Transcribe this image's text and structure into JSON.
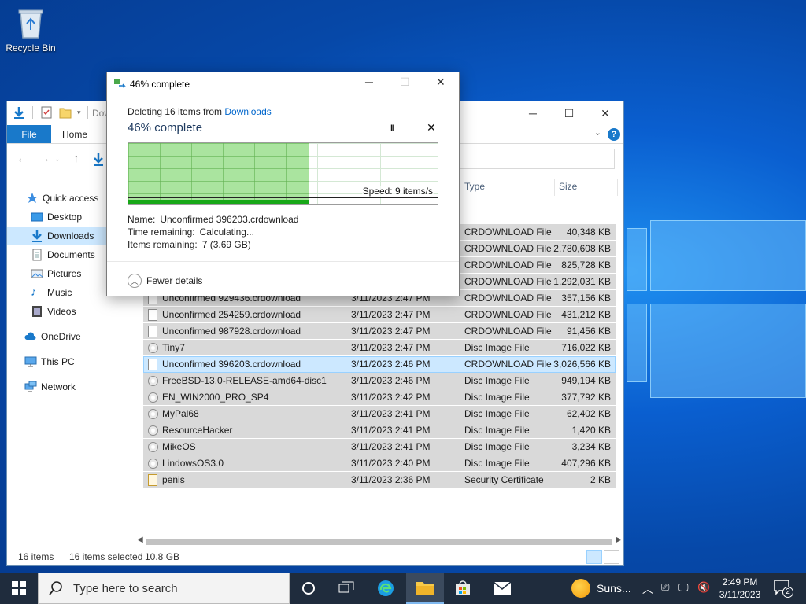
{
  "desktop": {
    "recycle_bin_label": "Recycle Bin"
  },
  "explorer": {
    "title_partial": "Dow",
    "tabs": {
      "file": "File",
      "home": "Home"
    },
    "help_label": "?",
    "nav": {
      "quick_access": "Quick access",
      "desktop": "Desktop",
      "downloads": "Downloads",
      "documents": "Documents",
      "pictures": "Pictures",
      "music": "Music",
      "videos": "Videos",
      "onedrive": "OneDrive",
      "this_pc": "This PC",
      "network": "Network"
    },
    "columns": {
      "type": "Type",
      "size": "Size"
    },
    "files": [
      {
        "name": "",
        "date": "",
        "type": "CRDOWNLOAD File",
        "size": "40,348 KB",
        "icon": "file-icon"
      },
      {
        "name": "",
        "date": "",
        "type": "CRDOWNLOAD File",
        "size": "2,780,608 KB",
        "icon": "file-icon"
      },
      {
        "name": "",
        "date": "",
        "type": "CRDOWNLOAD File",
        "size": "825,728 KB",
        "icon": "file-icon"
      },
      {
        "name": "",
        "date": "",
        "type": "CRDOWNLOAD File",
        "size": "1,292,031 KB",
        "icon": "file-icon"
      },
      {
        "name": "Unconfirmed 929436.crdownload",
        "date": "3/11/2023 2:47 PM",
        "type": "CRDOWNLOAD File",
        "size": "357,156 KB",
        "icon": "file-icon"
      },
      {
        "name": "Unconfirmed 254259.crdownload",
        "date": "3/11/2023 2:47 PM",
        "type": "CRDOWNLOAD File",
        "size": "431,212 KB",
        "icon": "file-icon"
      },
      {
        "name": "Unconfirmed 987928.crdownload",
        "date": "3/11/2023 2:47 PM",
        "type": "CRDOWNLOAD File",
        "size": "91,456 KB",
        "icon": "file-icon"
      },
      {
        "name": "Tiny7",
        "date": "3/11/2023 2:47 PM",
        "type": "Disc Image File",
        "size": "716,022 KB",
        "icon": "disc-image-icon"
      },
      {
        "name": "Unconfirmed 396203.crdownload",
        "date": "3/11/2023 2:46 PM",
        "type": "CRDOWNLOAD File",
        "size": "3,026,566 KB",
        "icon": "file-icon"
      },
      {
        "name": "FreeBSD-13.0-RELEASE-amd64-disc1",
        "date": "3/11/2023 2:46 PM",
        "type": "Disc Image File",
        "size": "949,194 KB",
        "icon": "disc-image-icon"
      },
      {
        "name": "EN_WIN2000_PRO_SP4",
        "date": "3/11/2023 2:42 PM",
        "type": "Disc Image File",
        "size": "377,792 KB",
        "icon": "disc-image-icon"
      },
      {
        "name": "MyPal68",
        "date": "3/11/2023 2:41 PM",
        "type": "Disc Image File",
        "size": "62,402 KB",
        "icon": "disc-image-icon"
      },
      {
        "name": "ResourceHacker",
        "date": "3/11/2023 2:41 PM",
        "type": "Disc Image File",
        "size": "1,420 KB",
        "icon": "disc-image-icon"
      },
      {
        "name": "MikeOS",
        "date": "3/11/2023 2:41 PM",
        "type": "Disc Image File",
        "size": "3,234 KB",
        "icon": "disc-image-icon"
      },
      {
        "name": "LindowsOS3.0",
        "date": "3/11/2023 2:40 PM",
        "type": "Disc Image File",
        "size": "407,296 KB",
        "icon": "disc-image-icon"
      },
      {
        "name": "penis",
        "date": "3/11/2023 2:36 PM",
        "type": "Security Certificate",
        "size": "2 KB",
        "icon": "certificate-icon"
      }
    ],
    "status": {
      "item_count": "16 items",
      "selected": "16 items selected",
      "selected_size": "10.8 GB"
    }
  },
  "dialog": {
    "title": "46% complete",
    "subtitle_prefix": "Deleting 16 items from",
    "subtitle_link": "Downloads",
    "heading": "46% complete",
    "pause_label": "II",
    "cancel_label": "✕",
    "progress_fraction": 0.585,
    "speed": "Speed: 9 items/s",
    "name_label": "Name:",
    "name_value": "Unconfirmed 396203.crdownload",
    "time_label": "Time remaining:",
    "time_value": "Calculating...",
    "items_label": "Items remaining:",
    "items_value": "7 (3.69 GB)",
    "fewer_details": "Fewer details"
  },
  "taskbar": {
    "search_placeholder": "Type here to search",
    "weather": "Suns...",
    "time": "2:49 PM",
    "date": "3/11/2023",
    "notification_count": "2"
  },
  "colors": {
    "accent": "#1979ca",
    "progress_fill": "#64cd50",
    "selection": "#cce8ff",
    "taskbar": "#1f2c3d"
  }
}
